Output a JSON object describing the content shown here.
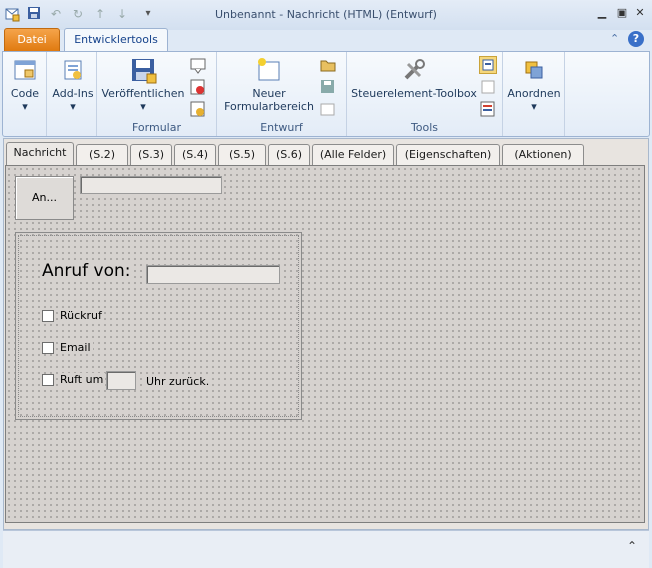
{
  "window": {
    "title": "Unbenannt  -  Nachricht (HTML)  (Entwurf)"
  },
  "ribbon_tabs": {
    "file": "Datei",
    "developer": "Entwicklertools"
  },
  "ribbon": {
    "groups": {
      "formular": "Formular",
      "entwurf": "Entwurf",
      "tools": "Tools"
    },
    "buttons": {
      "code": "Code",
      "addins": "Add-Ins",
      "publish": "Veröffentlichen",
      "new_region_line1": "Neuer",
      "new_region_line2": "Formularbereich",
      "toolbox": "Steuerelement-Toolbox",
      "arrange": "Anordnen"
    }
  },
  "form_tabs": [
    "Nachricht",
    "(S.2)",
    "(S.3)",
    "(S.4)",
    "(S.5)",
    "(S.6)",
    "(Alle Felder)",
    "(Eigenschaften)",
    "(Aktionen)"
  ],
  "form": {
    "to_button": "An...",
    "call_from_label": "Anruf von:",
    "checkbox_callback": "Rückruf",
    "checkbox_email": "Email",
    "checkbox_callsback": "Ruft um",
    "suffix_text": "Uhr zurück."
  },
  "colors": {
    "file_tab": "#e07a10",
    "ribbon_bg": "#e3ecf7",
    "form_canvas": "#d6d2cf"
  }
}
